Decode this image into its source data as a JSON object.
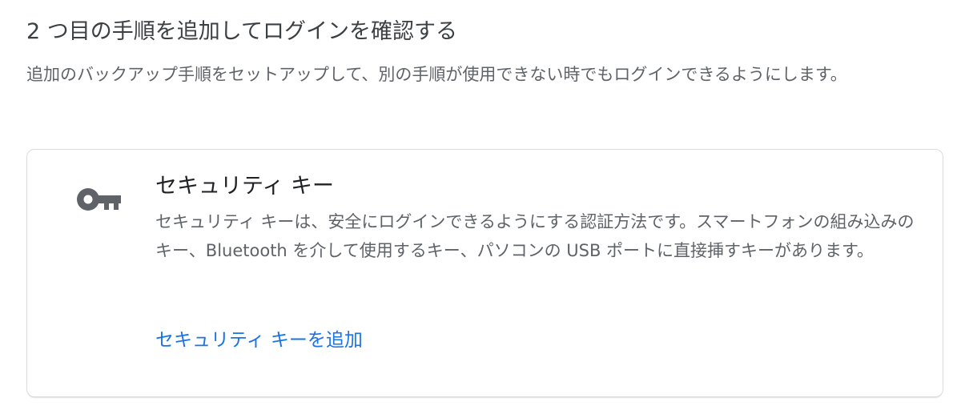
{
  "section": {
    "title": "2 つ目の手順を追加してログインを確認する",
    "description": "追加のバックアップ手順をセットアップして、別の手順が使用できない時でもログインできるようにします。"
  },
  "security_key_card": {
    "icon": "key-icon",
    "title": "セキュリティ キー",
    "description": "セキュリティ キーは、安全にログインできるようにする認証方法です。スマートフォンの組み込みのキー、Bluetooth を介して使用するキー、パソコンの USB ポートに直接挿すキーがあります。",
    "action_label": "セキュリティ キーを追加"
  },
  "colors": {
    "link": "#1a73e8",
    "icon": "#5f6368",
    "border": "#dadce0"
  }
}
